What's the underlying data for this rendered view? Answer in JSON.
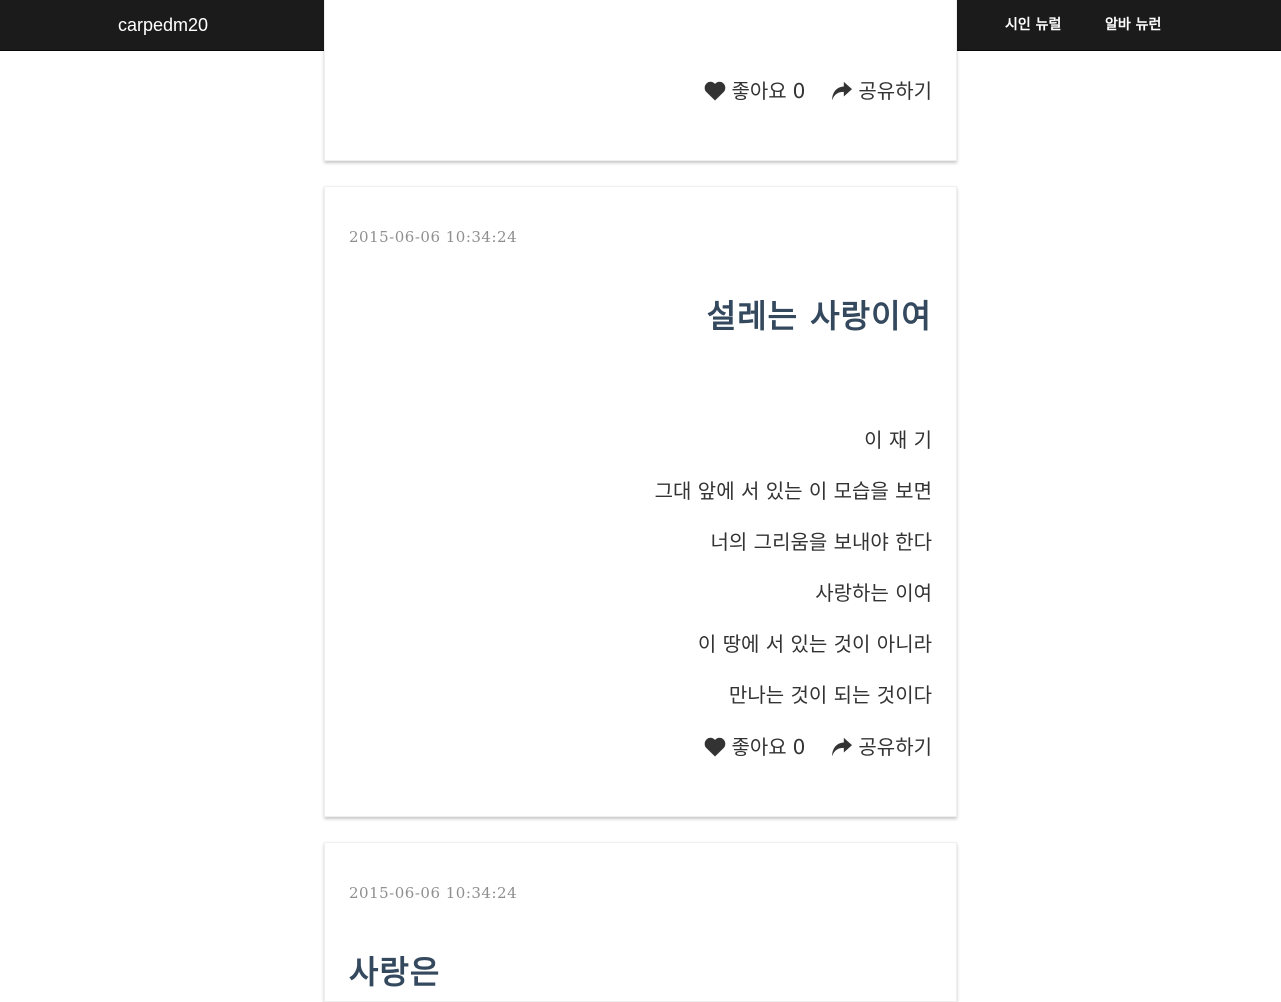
{
  "navbar": {
    "brand": "carpedm20",
    "links": [
      "시인 뉴럴",
      "알바 뉴런"
    ]
  },
  "posts": [
    {
      "actions": {
        "like_label": "좋아요",
        "like_count": "0",
        "share_label": "공유하기"
      }
    },
    {
      "date": "2015-06-06 10:34:24",
      "title": "설레는 사랑이여",
      "lines": [
        "이 재 기",
        "그대 앞에 서 있는 이 모습을 보면",
        "너의 그리움을 보내야 한다",
        "사랑하는 이여",
        "이 땅에 서 있는 것이 아니라",
        "만나는 것이 되는 것이다"
      ],
      "actions": {
        "like_label": "좋아요",
        "like_count": "0",
        "share_label": "공유하기"
      }
    },
    {
      "date": "2015-06-06 10:34:24",
      "title": "사랑은"
    }
  ],
  "colors": {
    "navbar_bg": "#1b1b1b",
    "title": "#34495e",
    "date": "#8f8f8f",
    "text": "#333333"
  },
  "icons": {
    "like": "heart-icon",
    "share": "share-arrow-icon"
  }
}
